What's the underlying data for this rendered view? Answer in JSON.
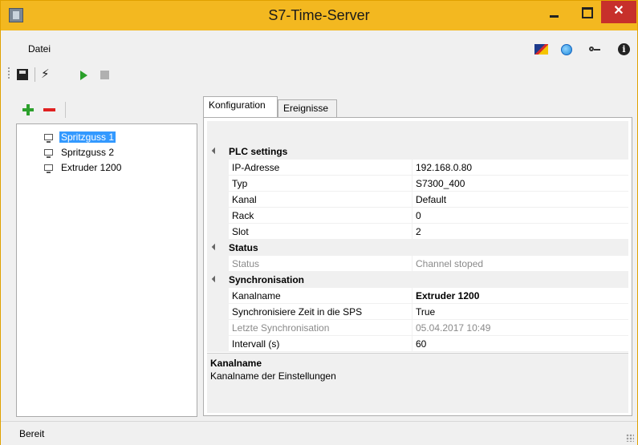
{
  "window": {
    "title": "S7-Time-Server",
    "close_label": "✕"
  },
  "menu": {
    "file": "Datei"
  },
  "toolbar": {
    "icons": [
      "save-icon",
      "lightning-icon",
      "play-icon",
      "stop-icon"
    ]
  },
  "menu_icons": [
    "flag-icon",
    "globe-icon",
    "key-icon",
    "info-icon"
  ],
  "info_glyph": "i",
  "bolt_glyph": "⚡",
  "tree": {
    "items": [
      {
        "label": "Spritzguss 1",
        "selected": true
      },
      {
        "label": "Spritzguss 2",
        "selected": false
      },
      {
        "label": "Extruder 1200",
        "selected": false
      }
    ]
  },
  "tabs": [
    {
      "label": "Konfiguration",
      "active": true
    },
    {
      "label": "Ereignisse",
      "active": false
    }
  ],
  "property_grid": {
    "categories": [
      {
        "name": "PLC settings",
        "properties": [
          {
            "name": "IP-Adresse",
            "value": "192.168.0.80"
          },
          {
            "name": "Typ",
            "value": "S7300_400"
          },
          {
            "name": "Kanal",
            "value": "Default"
          },
          {
            "name": "Rack",
            "value": "0"
          },
          {
            "name": "Slot",
            "value": "2"
          }
        ]
      },
      {
        "name": "Status",
        "properties": [
          {
            "name": "Status",
            "value": "Channel stoped"
          }
        ]
      },
      {
        "name": "Synchronisation",
        "properties": [
          {
            "name": "Kanalname",
            "value": "Extruder 1200"
          },
          {
            "name": "Synchronisiere Zeit in die SPS",
            "value": "True"
          },
          {
            "name": "Letzte Synchronisation",
            "value": "05.04.2017 10:49"
          },
          {
            "name": "Intervall (s)",
            "value": "60"
          }
        ]
      }
    ]
  },
  "help": {
    "title": "Kanalname",
    "description": "Kanalname der Einstellungen"
  },
  "status": {
    "text": "Bereit"
  }
}
